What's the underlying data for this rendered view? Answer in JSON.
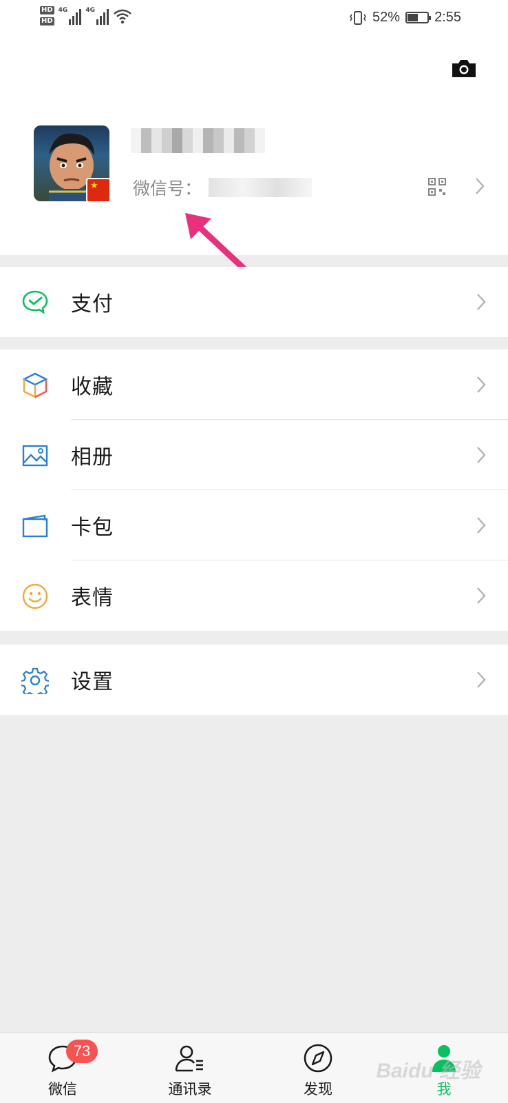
{
  "status_bar": {
    "hd1": "HD",
    "hd2": "HD",
    "sim1_label": "4G",
    "sim2_label": "4G",
    "battery_percent": "52%",
    "battery_level": 0.52,
    "time": "2:55"
  },
  "profile": {
    "wechat_id_label": "微信号：",
    "camera_icon": "camera-icon",
    "qr_icon": "qr-code-icon"
  },
  "menu": {
    "pay": {
      "label": "支付",
      "icon": "wechat-pay-icon",
      "color": "#07c160"
    },
    "favorites": {
      "label": "收藏",
      "icon": "favorites-cube-icon"
    },
    "album": {
      "label": "相册",
      "icon": "album-icon",
      "color": "#2a7fd4"
    },
    "card_wallet": {
      "label": "卡包",
      "icon": "card-wallet-icon",
      "color": "#2a7fd4"
    },
    "stickers": {
      "label": "表情",
      "icon": "sticker-smile-icon",
      "color": "#f0a83a"
    },
    "settings": {
      "label": "设置",
      "icon": "settings-gear-icon",
      "color": "#2a7fd4"
    }
  },
  "tabbar": {
    "chats": {
      "label": "微信",
      "badge": "73"
    },
    "contacts": {
      "label": "通讯录"
    },
    "discover": {
      "label": "发现"
    },
    "me": {
      "label": "我",
      "active": true,
      "color": "#07c160"
    }
  },
  "watermark": "Baidu 经验"
}
